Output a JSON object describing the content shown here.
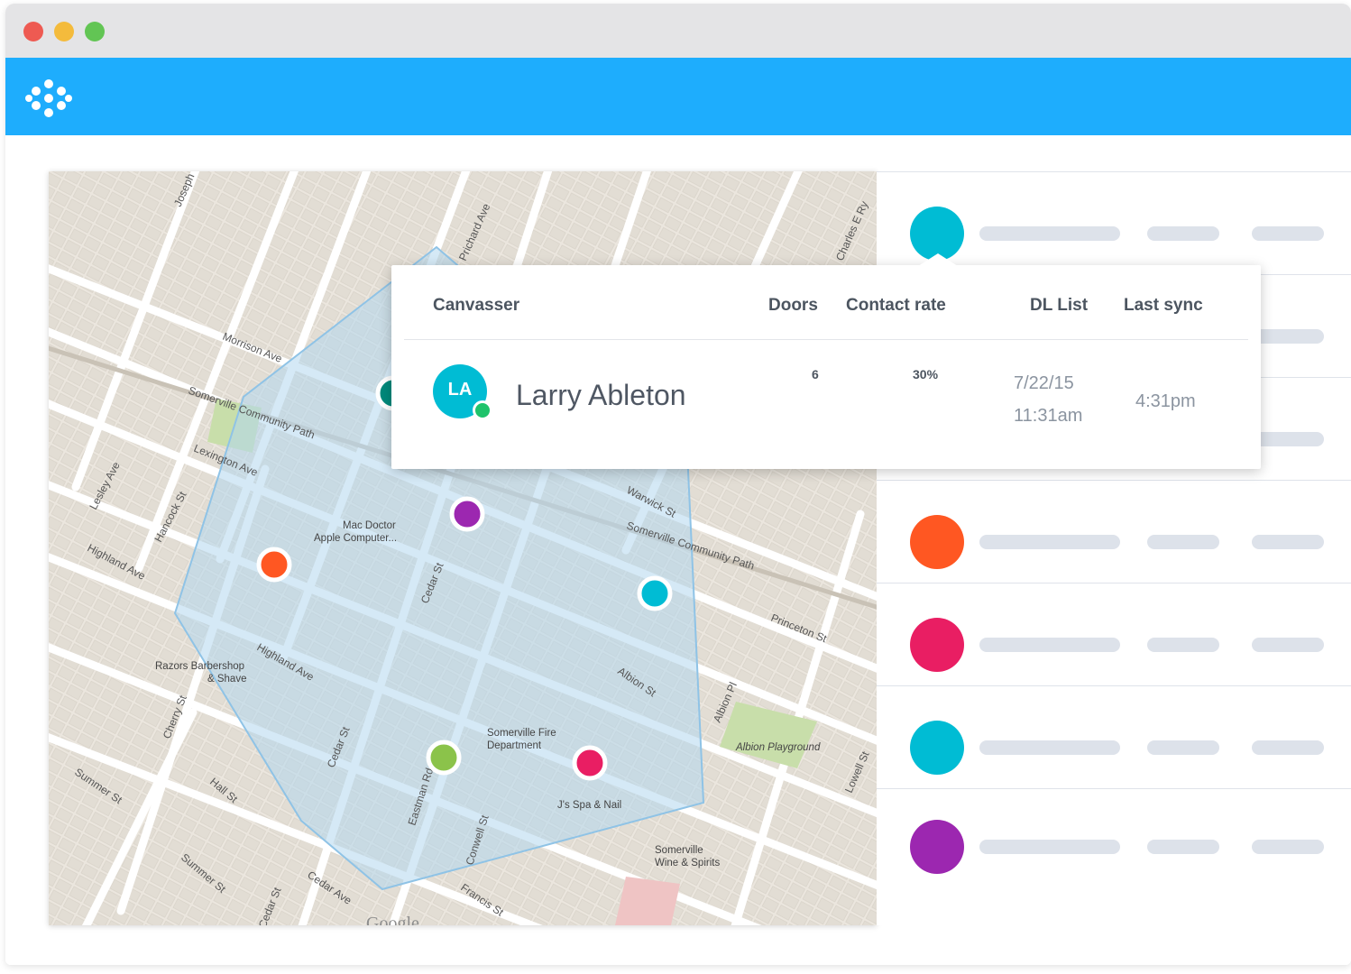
{
  "window": {
    "controls": [
      "close",
      "minimize",
      "maximize"
    ]
  },
  "app": {
    "logo_icon": "dots-flower-logo-icon",
    "brand_color": "#1eadfd"
  },
  "map": {
    "streets": [
      "Morrison Ave",
      "Somerville Community Path",
      "Lexington Ave",
      "Highland Ave",
      "Cedar St",
      "Warwick St",
      "Somerville Community Path",
      "Princeton St",
      "Albion St",
      "Albion Pl",
      "Hancock St",
      "Lesley Ave",
      "Summer St",
      "Hall St",
      "Cherry St",
      "Eastman Rd",
      "Conwell St",
      "Francis St",
      "Cedar Ave",
      "Prichard Ave",
      "Joseph",
      "Lowell St",
      "Charles E Ry",
      "Highland Ave",
      "Summer St",
      "Cedar St"
    ],
    "pois": [
      {
        "name": "Mac Doctor",
        "sub": "Apple Computer..."
      },
      {
        "name": "Razors Barbershop",
        "sub": "& Shave"
      },
      {
        "name": "Somerville Fire",
        "sub": "Department"
      },
      {
        "name": "J's Spa & Nail",
        "sub": ""
      },
      {
        "name": "Somerville",
        "sub": "Wine & Spirits"
      },
      {
        "name": "Albion Playground",
        "sub": ""
      }
    ],
    "attribution": "Google",
    "markers": [
      {
        "color": "#00897b"
      },
      {
        "color": "#9c27b0"
      },
      {
        "color": "#ff5722"
      },
      {
        "color": "#00bcd4"
      },
      {
        "color": "#8bc34a"
      },
      {
        "color": "#e91e63"
      }
    ]
  },
  "popup": {
    "headers": {
      "canvasser": "Canvasser",
      "doors": "Doors",
      "contact_rate": "Contact rate",
      "dl_list": "DL List",
      "last_sync": "Last sync"
    },
    "row": {
      "initials": "LA",
      "name": "Larry Ableton",
      "doors": "6",
      "contact_rate": "30%",
      "dl_list_date": "7/22/15",
      "dl_list_time": "11:31am",
      "last_sync": "4:31pm",
      "status_color": "#1fc36b"
    }
  },
  "list": {
    "rows": [
      {
        "color": "#00bcd4"
      },
      {
        "color": "#ffffff"
      },
      {
        "color": "#ffffff"
      },
      {
        "color": "#ff5722"
      },
      {
        "color": "#e91e63"
      },
      {
        "color": "#00bcd4"
      },
      {
        "color": "#9c27b0"
      }
    ]
  }
}
